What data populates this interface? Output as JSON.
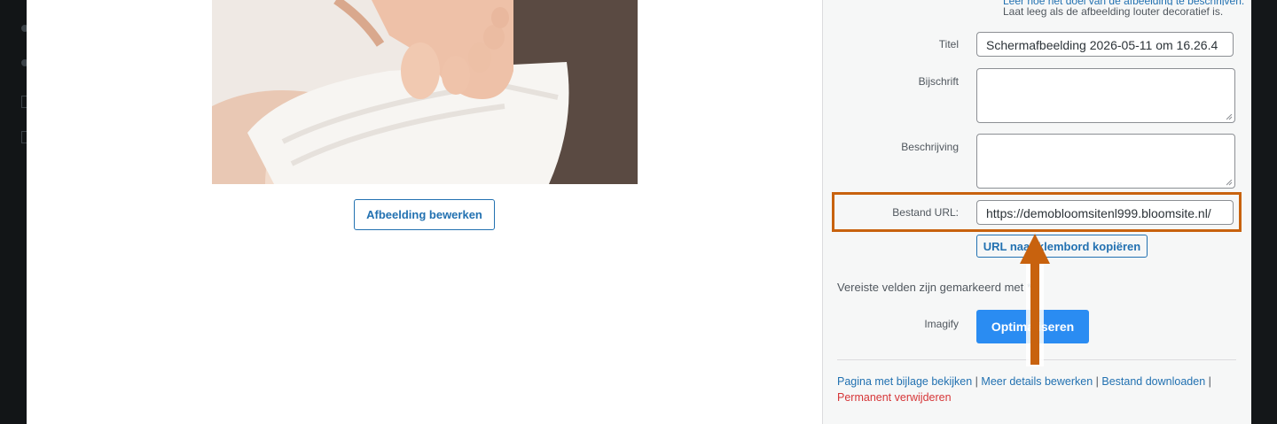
{
  "preview": {
    "edit_image_button": "Afbeelding bewerken"
  },
  "attachment_details": {
    "alt_help": "Laat leeg als de afbeelding louter decoratief is.",
    "alt_help_link": "Leer hoe het doel van de afbeelding te beschrijven.",
    "title_label": "Titel",
    "title_value": "Schermafbeelding 2026-05-11 om 16.26.4",
    "caption_label": "Bijschrift",
    "caption_value": "",
    "description_label": "Beschrijving",
    "description_value": "",
    "file_url_label": "Bestand URL:",
    "file_url_value": "https://demobloomsitenl999.bloomsite.nl/",
    "copy_url_button": "URL naar klembord kopiëren",
    "required_note": "Vereiste velden zijn gemarkeerd met *",
    "imagify_label": "Imagify",
    "optimize_button": "Optimaliseren"
  },
  "actions": {
    "view_attachment_page": "Pagina met bijlage bekijken",
    "edit_more_details": "Meer details bewerken",
    "download_file": "Bestand downloaden",
    "separator": "|",
    "delete_permanently": "Permanent verwijderen"
  },
  "colors": {
    "link": "#2271b1",
    "delete": "#d63638",
    "highlight_annotation": "#c8620e",
    "primary_button": "#2a8cf2"
  },
  "icons": {
    "annotation": "arrow-up-icon"
  }
}
